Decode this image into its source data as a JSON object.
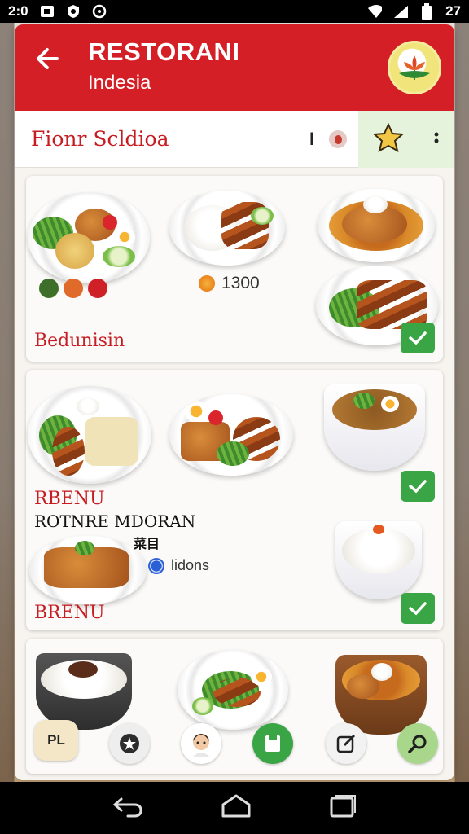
{
  "status_bar": {
    "time": "2:0",
    "battery": "27"
  },
  "header": {
    "title": "RESTORANI",
    "subtitle": "Indesia"
  },
  "subbar": {
    "title": "Fionr Scldioa",
    "mid_text": "I"
  },
  "card1": {
    "label": "Bedunisin",
    "price": "1300"
  },
  "card2": {
    "label1": "RBENU",
    "label2": "ROTNRE MDORAN",
    "label3": "BRENU",
    "tag": "菜目",
    "note": "lidons"
  },
  "bottom_badge": "PL",
  "icons": {
    "back": "arrow-left-icon",
    "logo": "flower-logo-icon",
    "favorite": "star-icon",
    "more": "more-vertical-icon",
    "check": "check-icon",
    "search": "search-icon"
  },
  "colors": {
    "primary": "#d41f26",
    "accent_green": "#3aa544",
    "favorite_tint": "#e5f3dc"
  }
}
